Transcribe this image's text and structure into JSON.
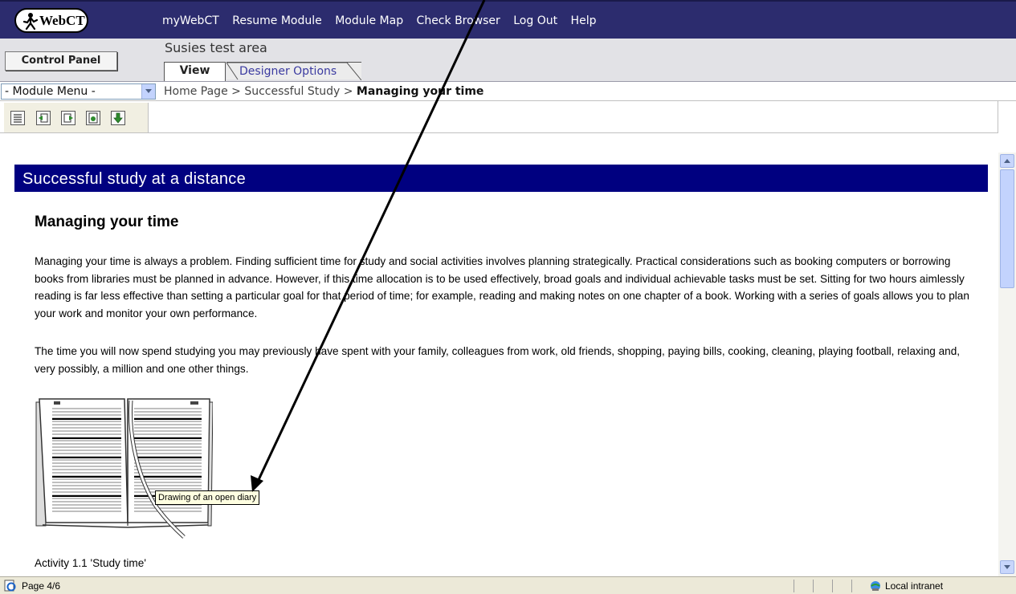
{
  "app": {
    "logo_text": "WebCT",
    "nav": [
      "myWebCT",
      "Resume Module",
      "Module Map",
      "Check Browser",
      "Log Out",
      "Help"
    ]
  },
  "header": {
    "control_panel_label": "Control Panel",
    "area_title": "Susies test area",
    "tabs": [
      {
        "label": "View",
        "active": true
      },
      {
        "label": "Designer Options",
        "active": false
      }
    ]
  },
  "module_menu": {
    "selected": "- Module Menu -"
  },
  "breadcrumb": {
    "items": [
      "Home Page",
      "Successful Study"
    ],
    "separator": ">",
    "current": "Managing your time"
  },
  "toolbar": {
    "icons": [
      "table-of-contents-icon",
      "previous-page-icon",
      "next-page-icon",
      "print-page-icon",
      "download-icon"
    ]
  },
  "content": {
    "banner": "Successful study at a distance",
    "heading": "Managing your time",
    "paragraphs": [
      "Managing your time is always a problem. Finding sufficient time for study and social activities involves planning strategically. Practical considerations such as booking computers or borrowing books from libraries must be planned in advance. However, if this time allocation is to be used effectively, broad goals and individual achievable tasks must be set. Sitting for two hours aimlessly reading is far less effective than setting a particular goal for that period of time; for example, reading and making notes on one chapter of a book. Working with a series of goals allows you to plan your work and monitor your own performance.",
      "The time you will now spend studying you may previously have spent with your family, colleagues from work, old friends, shopping, paying bills, cooking, cleaning, playing football, relaxing and, very possibly, a million and one other things."
    ],
    "image_tooltip": "Drawing of an open diary",
    "activity_label": "Activity 1.1 'Study time'"
  },
  "statusbar": {
    "status": "Page 4/6",
    "zone": "Local intranet"
  },
  "colors": {
    "topbar": "#2c2c6e",
    "banner": "#000080",
    "header_bg": "#e2e2e6",
    "tab_link": "#3a3aa0",
    "tooltip_bg": "#ffffe1",
    "statusbar_bg": "#ece9d8"
  }
}
